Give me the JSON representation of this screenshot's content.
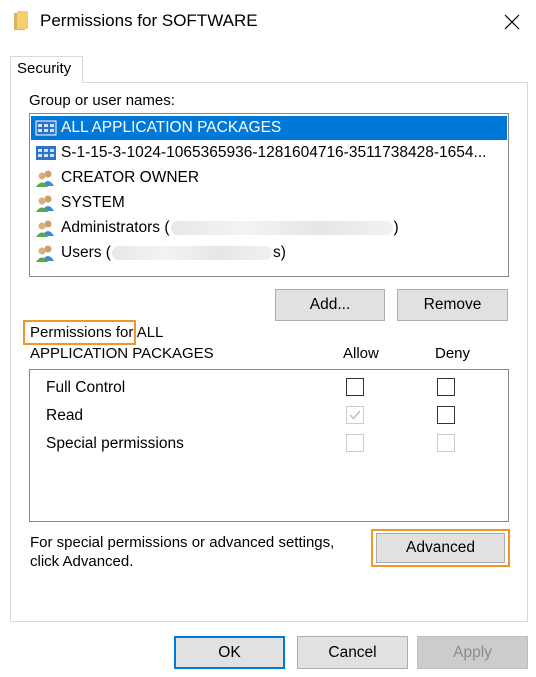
{
  "window": {
    "title": "Permissions for SOFTWARE",
    "close_symbol": "✕"
  },
  "tabs": [
    "Security"
  ],
  "group_label": "Group or user names:",
  "users": [
    {
      "name": "ALL APPLICATION PACKAGES",
      "icon": "app-packages-icon",
      "selected": true
    },
    {
      "name": "S-1-15-3-1024-1065365936-1281604716-3511738428-1654...",
      "icon": "app-packages-icon",
      "selected": false
    },
    {
      "name": "CREATOR OWNER",
      "icon": "user-group-icon",
      "selected": false
    },
    {
      "name": "SYSTEM",
      "icon": "user-group-icon",
      "selected": false
    },
    {
      "name_prefix": "Administrators (",
      "name_suffix": ")",
      "icon": "user-group-icon",
      "selected": false
    },
    {
      "name_prefix": "Users (",
      "name_suffix": "s)",
      "icon": "user-group-icon",
      "selected": false
    }
  ],
  "buttons": {
    "add": "Add...",
    "remove": "Remove",
    "advanced": "Advanced",
    "ok": "OK",
    "cancel": "Cancel",
    "apply": "Apply"
  },
  "permissions_header_line1": "Permissions for ALL",
  "permissions_header_line2": "APPLICATION PACKAGES",
  "col_allow": "Allow",
  "col_deny": "Deny",
  "permissions": [
    {
      "name": "Full Control",
      "allow": false,
      "deny": false,
      "allow_disabled": false,
      "deny_disabled": false
    },
    {
      "name": "Read",
      "allow": true,
      "deny": false,
      "allow_disabled": true,
      "deny_disabled": false
    },
    {
      "name": "Special permissions",
      "allow": false,
      "deny": false,
      "allow_disabled": true,
      "deny_disabled": true
    }
  ],
  "advanced_hint_line1": "For special permissions or advanced settings,",
  "advanced_hint_line2": "click Advanced.",
  "colors": {
    "selection": "#0078d7",
    "highlight": "#f0962e",
    "default_button_border": "#0078d7"
  }
}
